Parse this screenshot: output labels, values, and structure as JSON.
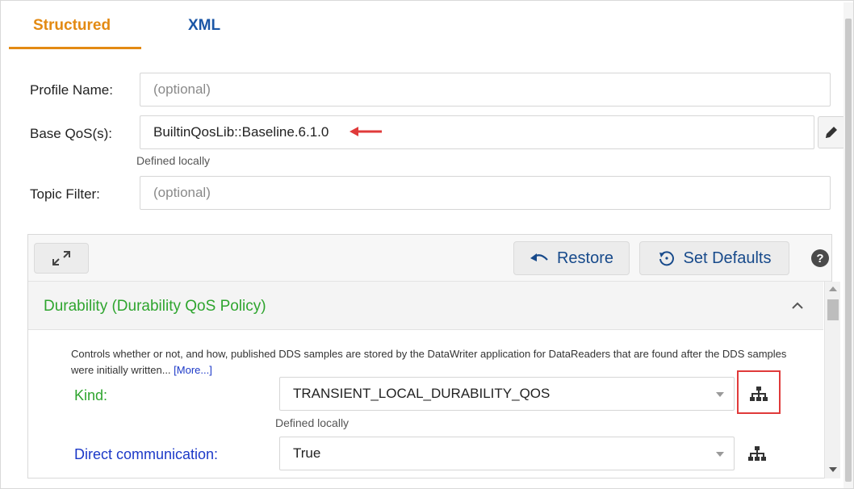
{
  "tabs": [
    {
      "label": "Structured",
      "active": true
    },
    {
      "label": "XML",
      "active": false
    }
  ],
  "form": {
    "profile_name": {
      "label": "Profile Name:",
      "placeholder": "(optional)"
    },
    "base_qos": {
      "label": "Base QoS(s):",
      "value": "BuiltinQosLib::Baseline.6.1.0",
      "hint": "Defined locally"
    },
    "topic_filter": {
      "label": "Topic Filter:",
      "placeholder": "(optional)"
    }
  },
  "toolbar": {
    "restore_label": "Restore",
    "set_defaults_label": "Set Defaults",
    "help_label": "?"
  },
  "section": {
    "title": "Durability (Durability QoS Policy)",
    "description": "Controls whether or not, and how, published DDS samples are stored by the DataWriter application for DataReaders that are found after the DDS samples were initially written...",
    "more_label": "[More...]"
  },
  "properties": [
    {
      "label": "Kind:",
      "value": "TRANSIENT_LOCAL_DURABILITY_QOS",
      "hint": "Defined locally",
      "label_color": "#2fa52f"
    },
    {
      "label": "Direct communication:",
      "value": "True",
      "label_color": "#1c39c8"
    }
  ],
  "colors": {
    "accent_orange": "#e38a13",
    "link_blue": "#1a56a6",
    "title_green": "#2fa52f",
    "annotation_red": "#e03a3a"
  },
  "icons": [
    "pencil-icon",
    "expand-icon",
    "undo-icon",
    "history-icon",
    "help-icon",
    "chevron-up-icon",
    "hierarchy-icon"
  ]
}
